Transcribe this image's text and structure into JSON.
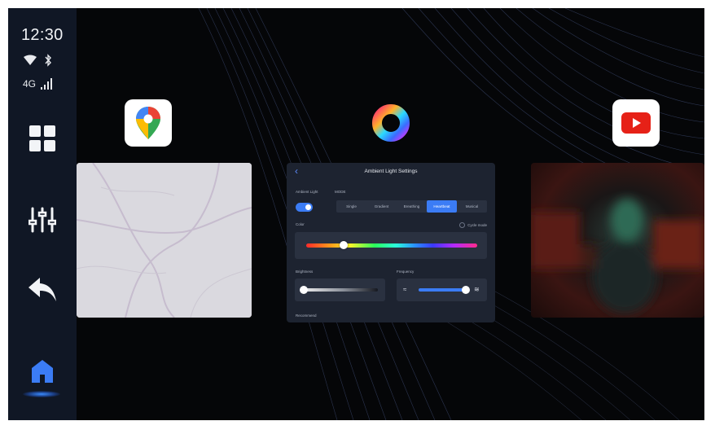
{
  "status": {
    "time": "12:30",
    "network": "4G",
    "icons": [
      "wifi-icon",
      "bluetooth-icon",
      "signal-icon"
    ]
  },
  "sidebar": {
    "items": [
      {
        "name": "apps-grid",
        "icon": "grid-icon"
      },
      {
        "name": "equalizer",
        "icon": "equalizer-icon"
      },
      {
        "name": "back",
        "icon": "back-arrow-icon"
      },
      {
        "name": "home",
        "icon": "home-icon",
        "active": true
      }
    ]
  },
  "apps": [
    {
      "name": "Google Maps",
      "icon": "maps-pin-icon"
    },
    {
      "name": "Ambient Light",
      "icon": "color-ring-icon"
    },
    {
      "name": "YouTube",
      "icon": "youtube-icon"
    }
  ],
  "ambient_panel": {
    "title": "Ambient Light Settings",
    "ambient_label": "Ambient Light",
    "mode_label": "MODE",
    "modes": [
      "Single",
      "Gradient",
      "Breathing",
      "Heartbeat",
      "Musical"
    ],
    "active_mode_index": 3,
    "color_label": "Color",
    "cycle_label": "Cycle mode",
    "brightness_label": "Brightness",
    "frequency_label": "Frequency",
    "recommend_label": "Recommend",
    "toggle_on": true,
    "color_position": 0.23,
    "brightness_level": 0.0,
    "frequency_level": 0.95
  },
  "colors": {
    "sidebar_bg": "#101725",
    "accent": "#3b7cf5",
    "panel_bg": "#1d2330"
  }
}
